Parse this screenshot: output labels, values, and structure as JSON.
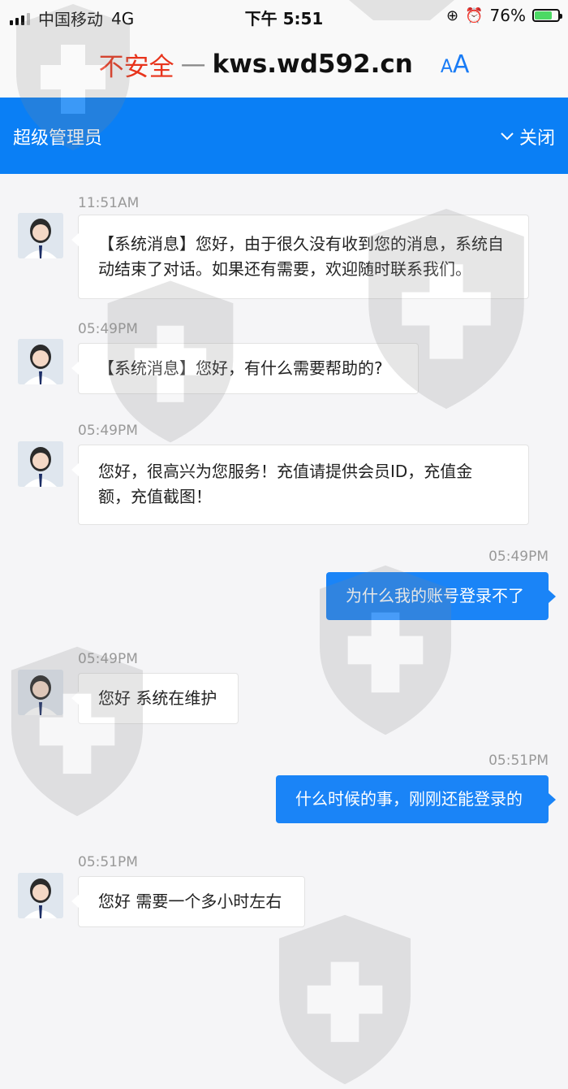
{
  "status_bar": {
    "carrier": "中国移动",
    "network": "4G",
    "time": "下午 5:51",
    "battery": "76%",
    "battery_level": 0.76
  },
  "address_bar": {
    "security_label": "不安全",
    "separator": "—",
    "url": "kws.wd592.cn",
    "text_size_button": "AA"
  },
  "header": {
    "title": "超级管理员",
    "close_label": "关闭"
  },
  "messages": [
    {
      "side": "in",
      "time": "11:51AM",
      "text": "【系统消息】您好，由于很久没有收到您的消息，系统自动结束了对话。如果还有需要，欢迎随时联系我们。"
    },
    {
      "side": "in",
      "time": "05:49PM",
      "text": "【系统消息】您好，有什么需要帮助的?"
    },
    {
      "side": "in",
      "time": "05:49PM",
      "text": "您好，很高兴为您服务！充值请提供会员ID，充值金额，充值截图！"
    },
    {
      "side": "out",
      "time": "05:49PM",
      "text": "为什么我的账号登录不了"
    },
    {
      "side": "in",
      "time": "05:49PM",
      "text": "您好 系统在维护"
    },
    {
      "side": "out",
      "time": "05:51PM",
      "text": "什么时候的事，刚刚还能登录的"
    },
    {
      "side": "in",
      "time": "05:51PM",
      "text": "您好 需要一个多小时左右"
    }
  ],
  "colors": {
    "header_bg": "#0a7ff5",
    "outgoing_bubble": "#1a84f7",
    "insecure_text": "#e8341c"
  }
}
